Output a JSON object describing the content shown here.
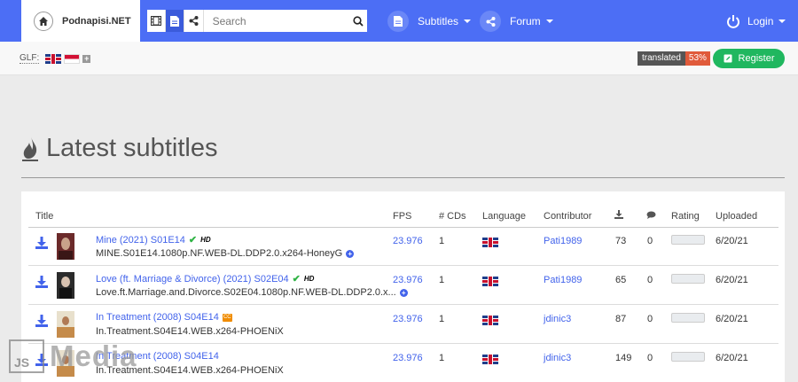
{
  "brand": {
    "name": "Podnapisi.NET"
  },
  "search": {
    "placeholder": "Search"
  },
  "nav": {
    "subtitles": "Subtitles",
    "forum": "Forum",
    "login": "Login"
  },
  "subbar": {
    "glf_label": "GLF:",
    "translated_label": "translated",
    "translated_pct": "53%",
    "register": "Register"
  },
  "page": {
    "heading": "Latest subtitles"
  },
  "table": {
    "headers": {
      "title": "Title",
      "fps": "FPS",
      "cds": "# CDs",
      "language": "Language",
      "contributor": "Contributor",
      "uploaded": "Uploaded",
      "rating": "Rating"
    },
    "rows": [
      {
        "title": "Mine (2021) S01E14",
        "release": "MINE.S01E14.1080p.NF.WEB-DL.DDP2.0.x264-HoneyG",
        "fps": "23.976",
        "cds": "1",
        "contributor": "Pati1989",
        "downloads": "73",
        "comments": "0",
        "uploaded": "6/20/21",
        "badge": "HD"
      },
      {
        "title": "Love (ft. Marriage & Divorce) (2021) S02E04",
        "release": "Love.ft.Marriage.and.Divorce.S02E04.1080p.NF.WEB-DL.DDP2.0.x...",
        "fps": "23.976",
        "cds": "1",
        "contributor": "Pati1989",
        "downloads": "65",
        "comments": "0",
        "uploaded": "6/20/21",
        "badge": "HD"
      },
      {
        "title": "In Treatment (2008) S04E14",
        "release": "In.Treatment.S04E14.WEB.x264-PHOENiX",
        "fps": "23.976",
        "cds": "1",
        "contributor": "jdinic3",
        "downloads": "87",
        "comments": "0",
        "uploaded": "6/20/21",
        "badge": "CC"
      },
      {
        "title": "In Treatment (2008) S04E14",
        "release": "In.Treatment.S04E14.WEB.x264-PHOENiX",
        "fps": "23.976",
        "cds": "1",
        "contributor": "jdinic3",
        "downloads": "149",
        "comments": "0",
        "uploaded": "6/20/21",
        "badge": ""
      }
    ]
  },
  "watermark": {
    "box": "JS",
    "text": "Media"
  },
  "colors": {
    "nav": "#4c6ef5",
    "link": "#4263eb",
    "register": "#20b75f",
    "translated_pct": "#e05a3a"
  },
  "icons": [
    "home-icon",
    "film-icon",
    "document-icon",
    "share-icon",
    "search-icon",
    "power-icon",
    "download-icon",
    "comment-icon",
    "check-icon",
    "plus-icon"
  ]
}
